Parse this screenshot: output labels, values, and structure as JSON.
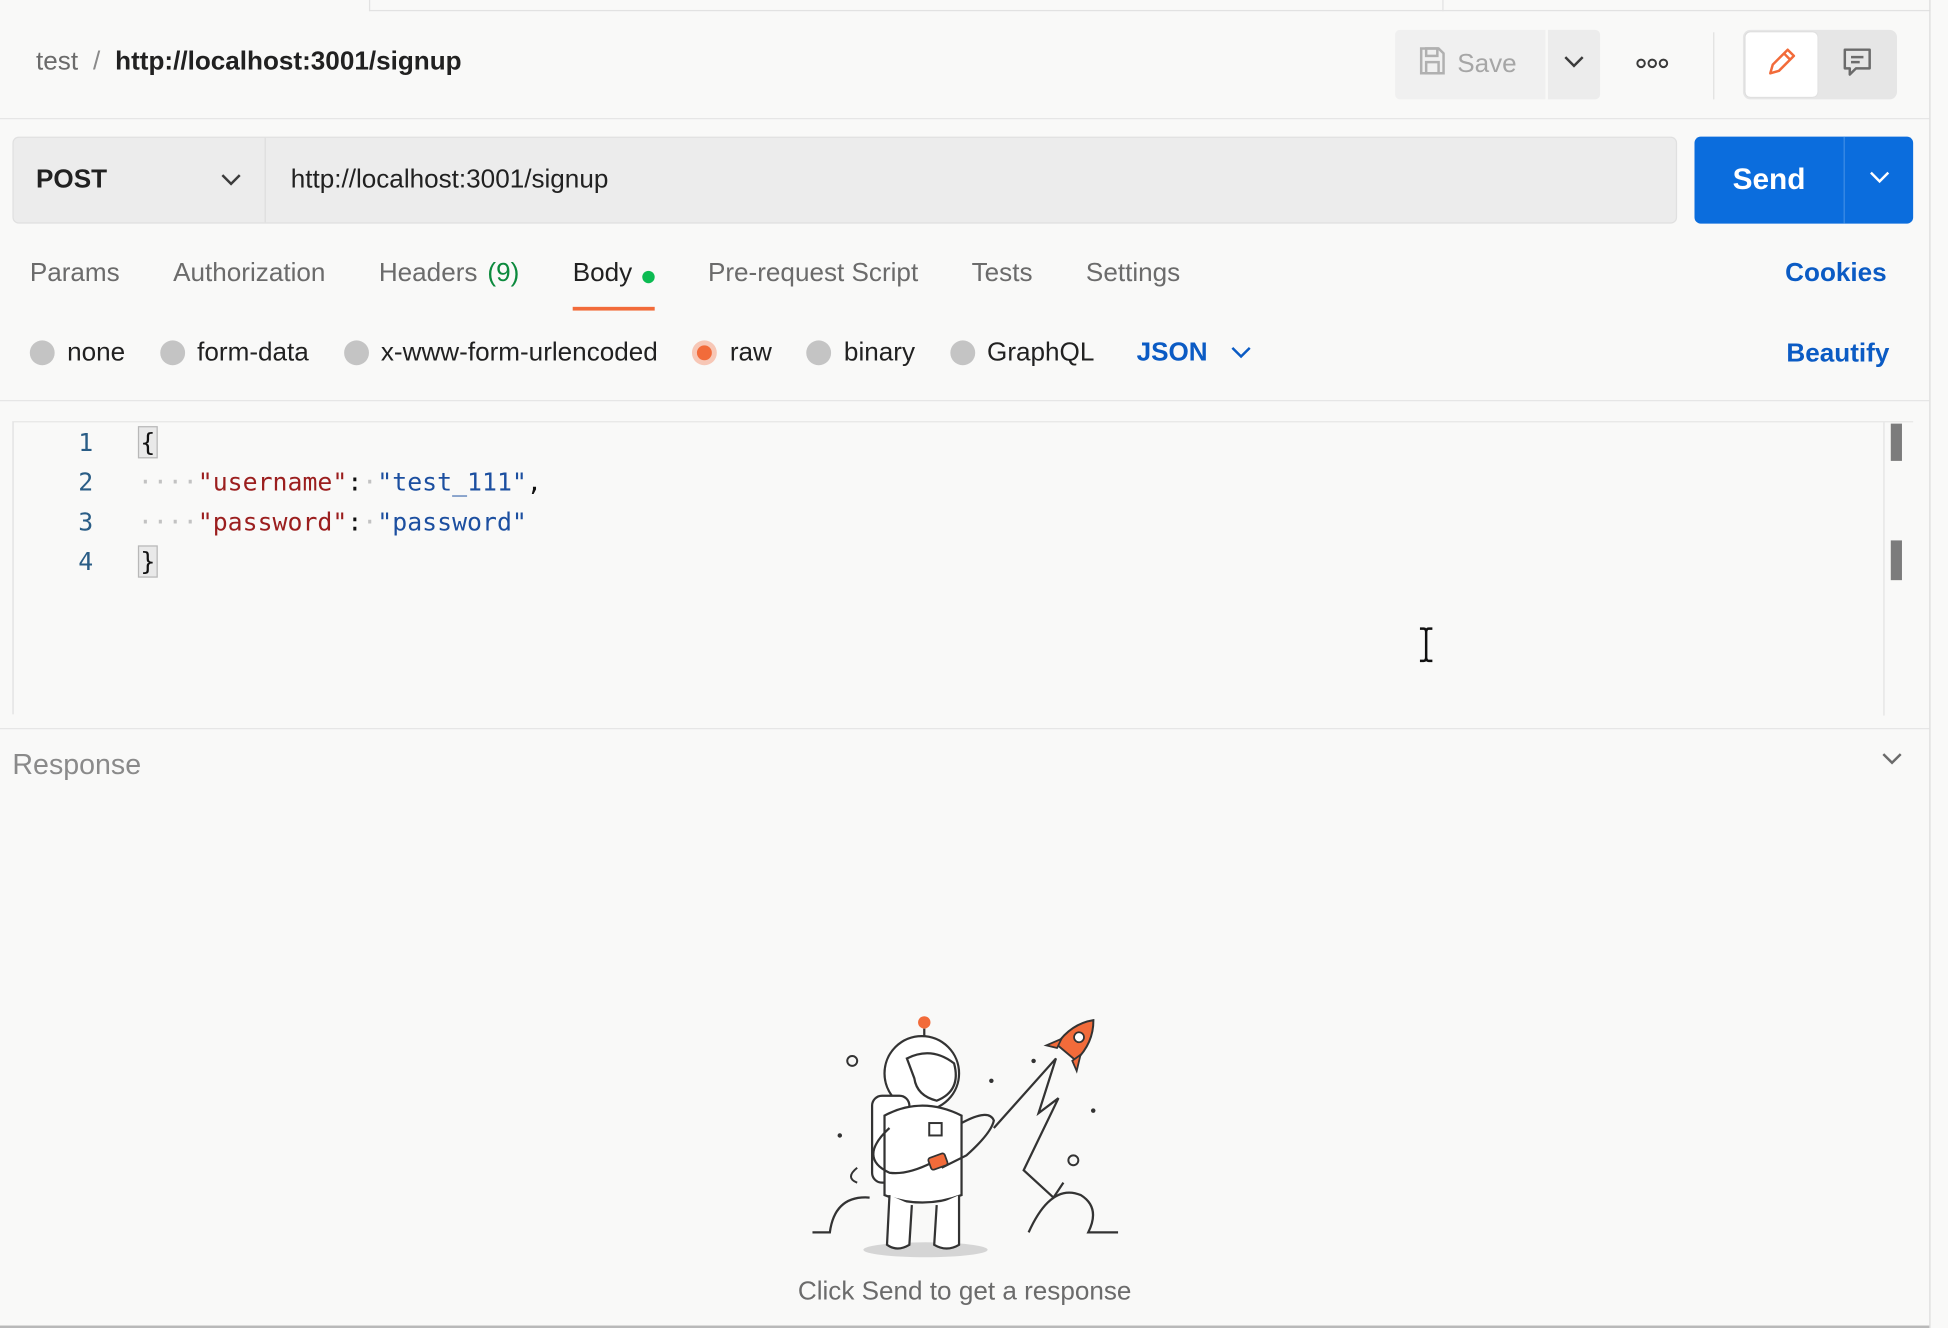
{
  "breadcrumb": {
    "parent": "test",
    "separator": "/",
    "current": "http://localhost:3001/signup"
  },
  "toolbar": {
    "save_label": "Save",
    "more_icon": "ellipsis-icon",
    "edit_icon": "pencil-icon",
    "comment_icon": "comment-icon"
  },
  "request": {
    "method": "POST",
    "url": "http://localhost:3001/signup",
    "send_label": "Send"
  },
  "tabs": [
    {
      "label": "Params"
    },
    {
      "label": "Authorization"
    },
    {
      "label": "Headers",
      "count": "(9)"
    },
    {
      "label": "Body",
      "active": true
    },
    {
      "label": "Pre-request Script"
    },
    {
      "label": "Tests"
    },
    {
      "label": "Settings"
    }
  ],
  "cookies_label": "Cookies",
  "body_modes": {
    "options": [
      "none",
      "form-data",
      "x-www-form-urlencoded",
      "raw",
      "binary",
      "GraphQL"
    ],
    "selected": "raw",
    "format": "JSON"
  },
  "beautify_label": "Beautify",
  "editor": {
    "line_numbers": [
      "1",
      "2",
      "3",
      "4"
    ],
    "open_brace": "{",
    "close_brace": "}",
    "indent": "····",
    "lines": [
      {
        "key": "\"username\"",
        "colon": ":",
        "space": "·",
        "value": "\"test_111\"",
        "comma": ","
      },
      {
        "key": "\"password\"",
        "colon": ":",
        "space": "·",
        "value": "\"password\"",
        "comma": ""
      }
    ]
  },
  "response": {
    "title": "Response",
    "empty_message": "Click Send to get a response"
  },
  "colors": {
    "accent_orange": "#f26b3a",
    "send_blue": "#0b6ddd",
    "link_blue": "#0b5bc4",
    "body_dot_green": "#0cbb52"
  }
}
